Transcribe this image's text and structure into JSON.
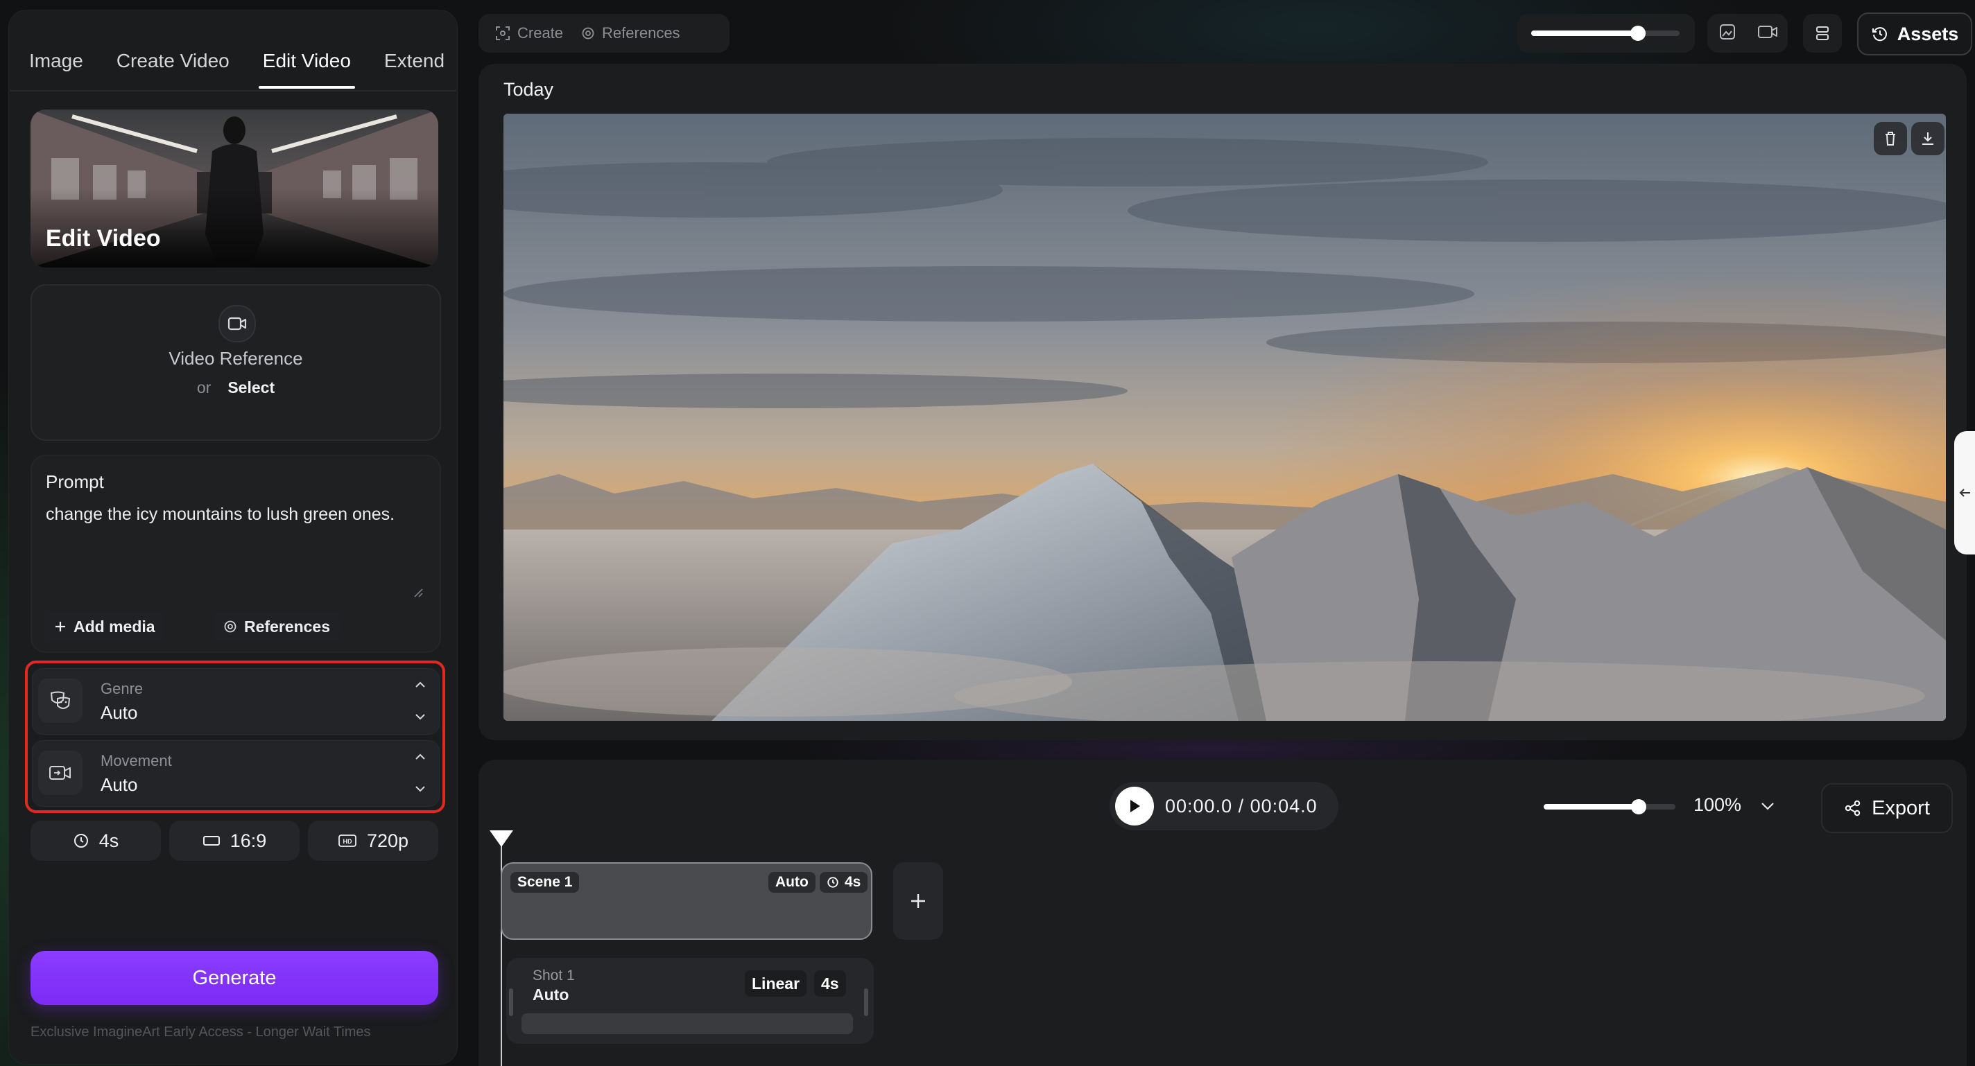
{
  "tabs": [
    "Image",
    "Create Video",
    "Edit Video",
    "Extend"
  ],
  "active_tab": "Edit Video",
  "hero": {
    "title": "Edit Video"
  },
  "video_reference": {
    "title": "Video Reference",
    "or_text": "or",
    "select_label": "Select"
  },
  "prompt": {
    "label": "Prompt",
    "value": "change the icy mountains to lush green ones.",
    "add_media_label": "Add media",
    "references_label": "References"
  },
  "genre": {
    "label": "Genre",
    "value": "Auto"
  },
  "movement": {
    "label": "Movement",
    "value": "Auto"
  },
  "options": {
    "duration": "4s",
    "aspect_ratio": "16:9",
    "resolution": "720p"
  },
  "generate_label": "Generate",
  "access_note": "Exclusive ImagineArt Early Access - Longer Wait Times",
  "toolbar": {
    "create_label": "Create",
    "references_label": "References",
    "assets_label": "Assets",
    "size_slider_value": 0.72
  },
  "preview": {
    "section_label": "Today"
  },
  "player": {
    "time_text": "00:00.0 / 00:04.0",
    "zoom_text": "100%",
    "zoom_slider_value": 0.72,
    "export_label": "Export"
  },
  "scene": {
    "label": "Scene 1",
    "mode": "Auto",
    "duration": "4s"
  },
  "shot": {
    "label": "Shot 1",
    "mode": "Auto",
    "motion": "Linear",
    "duration": "4s"
  },
  "colors": {
    "accent": "#7c2cf4",
    "highlight": "#e0291f"
  }
}
